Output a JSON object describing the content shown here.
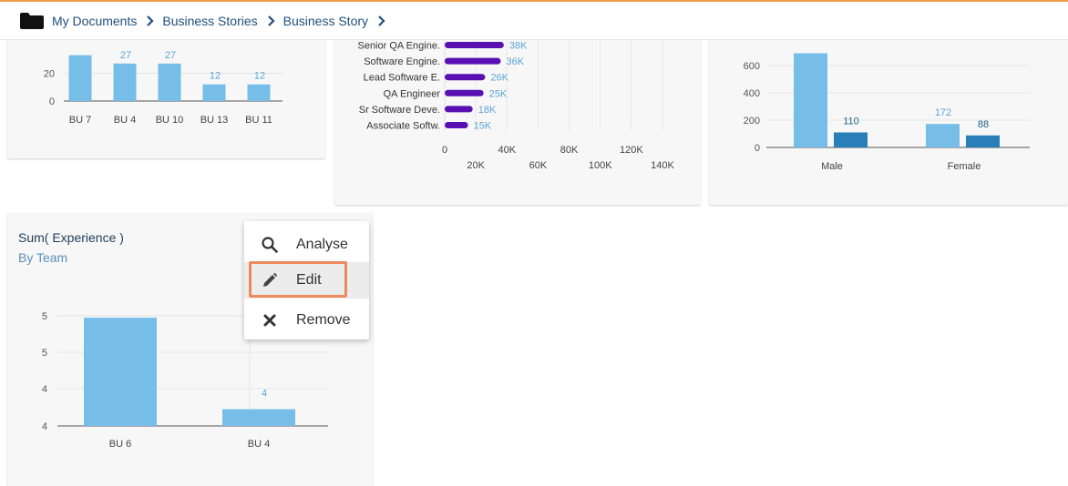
{
  "breadcrumb": {
    "items": [
      "My Documents",
      "Business Stories",
      "Business Story"
    ]
  },
  "card1": {
    "chart_data": {
      "type": "bar",
      "categories": [
        "BU 7",
        "BU 4",
        "BU 10",
        "BU 13",
        "BU 11"
      ],
      "values": [
        33,
        27,
        27,
        12,
        12
      ],
      "data_labels": [
        "",
        "27",
        "27",
        "12",
        "12"
      ],
      "yticks": [
        "0",
        "20"
      ],
      "ylim": [
        0,
        40
      ]
    }
  },
  "card2": {
    "chart_data": {
      "type": "bar",
      "orientation": "horizontal",
      "categories": [
        "Senior QA Engine.",
        "Software Engine.",
        "Lead Software E.",
        "QA Engineer",
        "Sr Software Deve.",
        "Associate Softw."
      ],
      "values": [
        38000,
        36000,
        26000,
        25000,
        18000,
        15000
      ],
      "data_labels": [
        "38K",
        "36K",
        "26K",
        "25K",
        "18K",
        "15K"
      ],
      "xticks_top": [
        "0",
        "40K",
        "80K",
        "120K"
      ],
      "xticks_bottom": [
        "20K",
        "60K",
        "100K",
        "140K"
      ],
      "xlim": [
        0,
        140000
      ]
    }
  },
  "card3": {
    "chart_data": {
      "type": "bar",
      "categories": [
        "Male",
        "Female"
      ],
      "series": [
        {
          "values": [
            690,
            172
          ]
        },
        {
          "values": [
            110,
            88
          ]
        }
      ],
      "data_labels": [
        [
          "",
          "172"
        ],
        [
          "110",
          "88"
        ]
      ],
      "yticks": [
        "0",
        "200",
        "400",
        "600"
      ],
      "ylim": [
        0,
        800
      ]
    }
  },
  "card4": {
    "title": "Sum( Experience )",
    "subtitle": "By Team",
    "chart_data": {
      "type": "bar",
      "categories": [
        "BU 6",
        "BU 4"
      ],
      "values": [
        5.5,
        4
      ],
      "data_labels": [
        "",
        "4"
      ],
      "yticks": [
        "4",
        "4",
        "5",
        "5"
      ]
    }
  },
  "context_menu": {
    "items": [
      {
        "label": "Analyse",
        "icon": "search-icon"
      },
      {
        "label": "Edit",
        "icon": "pencil-icon"
      },
      {
        "label": "Remove",
        "icon": "close-icon"
      }
    ]
  },
  "colors": {
    "bar_light": "#76bee8",
    "bar_dark": "#2a7fb9",
    "bar_purple": "#5a0fb2",
    "label_blue": "#5ba4d8",
    "highlight": "#ec8a5e"
  }
}
